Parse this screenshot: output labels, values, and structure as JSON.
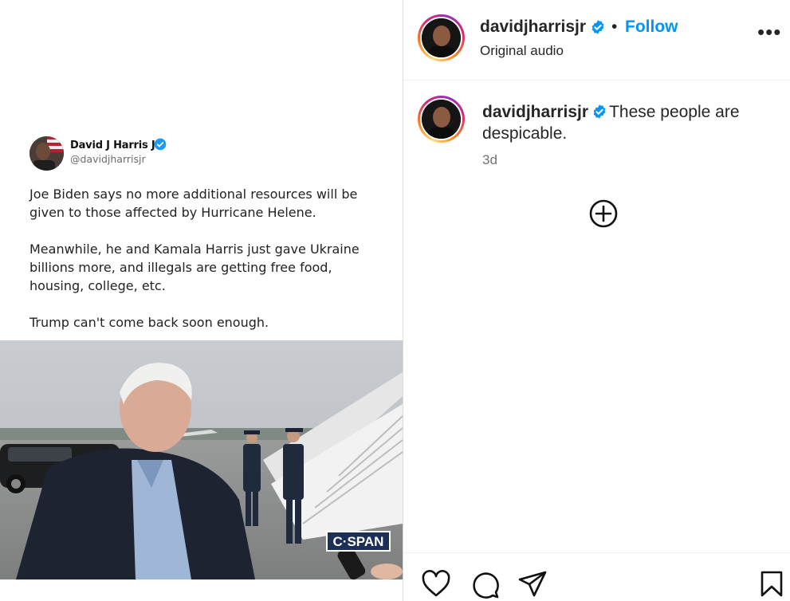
{
  "tweet": {
    "name": "David J Harris Jr",
    "handle": "@davidjharrisjr",
    "paragraphs": [
      "Joe Biden says no more additional resources will be given to those affected by Hurricane Helene.",
      "Meanwhile, he and Kamala Harris just gave Ukraine billions more, and illegals are getting free food, housing, college, etc.",
      "Trump can't come back soon enough."
    ]
  },
  "video": {
    "logo_text": "C·SPAN"
  },
  "header": {
    "username": "davidjharrisjr",
    "separator": "•",
    "follow_label": "Follow",
    "subtitle": "Original audio",
    "more_label": "•••"
  },
  "caption": {
    "username": "davidjharrisjr",
    "text": "These people are despicable.",
    "time": "3d"
  },
  "icons": {
    "verified": "verified-badge-icon",
    "more": "more-options-icon",
    "add": "add-comment-icon",
    "like": "heart-icon",
    "comment": "comment-icon",
    "share": "send-icon",
    "save": "bookmark-icon"
  },
  "colors": {
    "follow": "#0095f6",
    "verified": "#1d9bf0",
    "text": "#262626",
    "muted": "#737373"
  }
}
